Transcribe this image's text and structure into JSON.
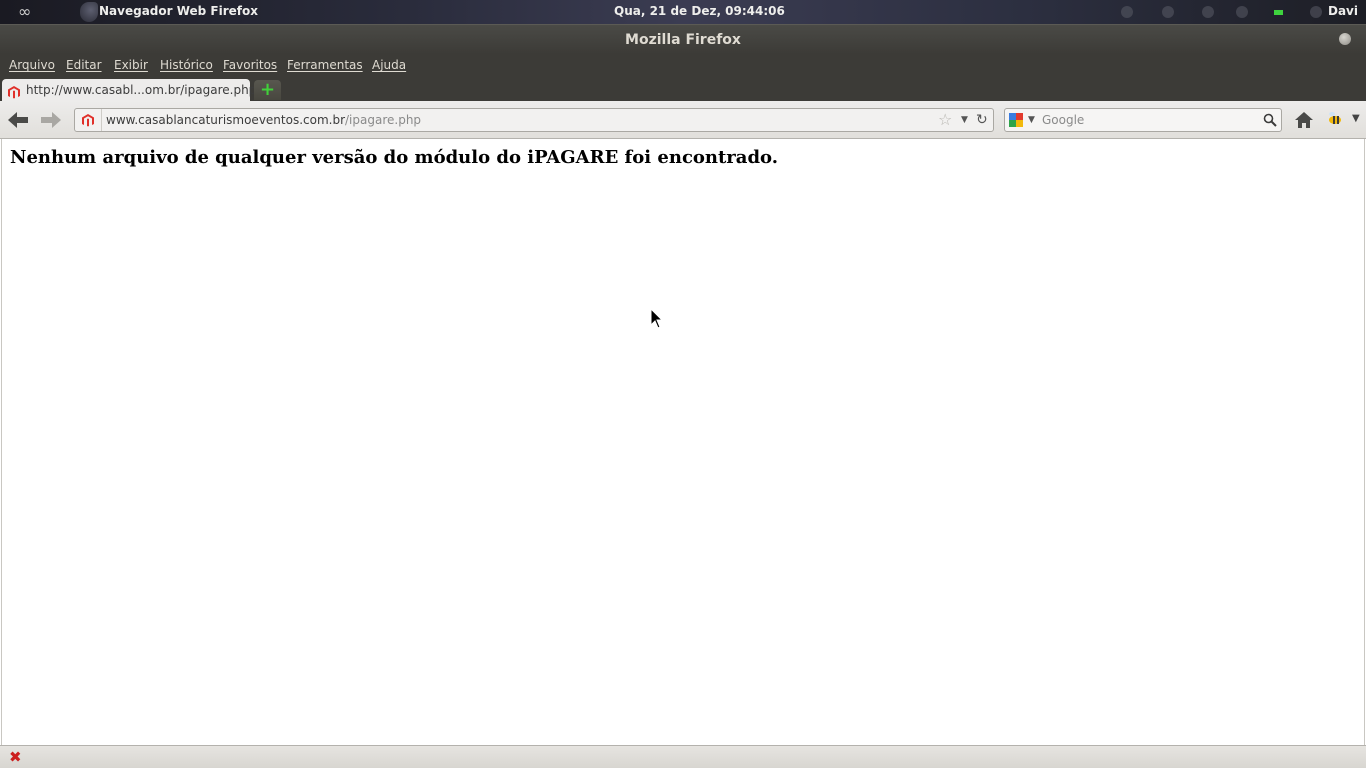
{
  "system_panel": {
    "app_name": "Navegador Web Firefox",
    "clock": "Qua, 21 de Dez, 09:44:06",
    "user": "Davi"
  },
  "window": {
    "title": "Mozilla Firefox"
  },
  "menubar": {
    "items": [
      "Arquivo",
      "Editar",
      "Exibir",
      "Histórico",
      "Favoritos",
      "Ferramentas",
      "Ajuda"
    ]
  },
  "tabs": [
    {
      "title": "http://www.casabl...om.br/ipagare.php",
      "active": true
    }
  ],
  "navbar": {
    "url_domain": "www.casablancaturismoeventos.com.br",
    "url_path": "/ipagare.php",
    "search_placeholder": "Google"
  },
  "page": {
    "heading": "Nenhum arquivo de qualquer versão do módulo do iPAGARE foi encontrado."
  },
  "colors": {
    "chrome_dark": "#3c3b37",
    "toolbar_light": "#edeceb",
    "favicon_red": "#e0302a",
    "newtab_green": "#41d13a",
    "close_red": "#cc1e1e"
  }
}
